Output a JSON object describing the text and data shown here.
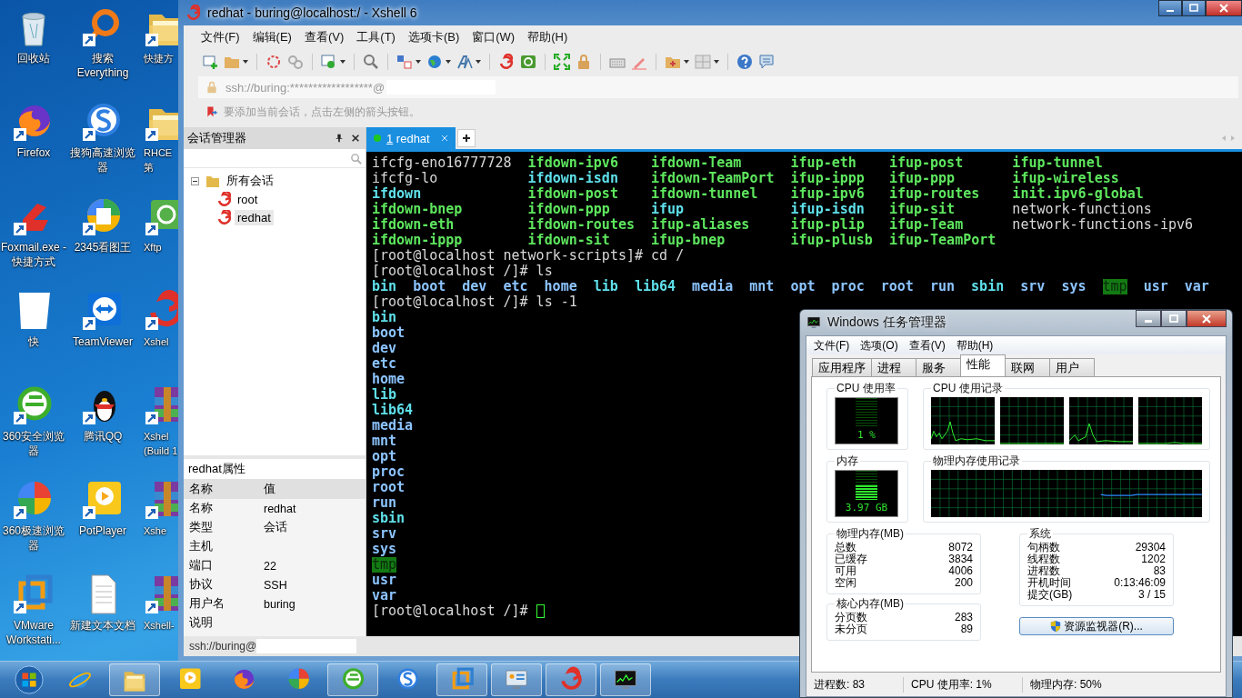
{
  "desktop_icons": [
    {
      "label": "回收站"
    },
    {
      "label": "搜索 Everything"
    },
    {
      "label": "快捷方"
    },
    {
      "label": "Firefox"
    },
    {
      "label": "搜狗高速浏览器"
    },
    {
      "label": "RHCE第"
    },
    {
      "label": "Foxmail.exe - 快捷方式"
    },
    {
      "label": "2345看图王"
    },
    {
      "label": "Xftp"
    },
    {
      "label": "快"
    },
    {
      "label": "TeamViewer"
    },
    {
      "label": "Xshel"
    },
    {
      "label": "360安全浏览器"
    },
    {
      "label": "腾讯QQ"
    },
    {
      "label": "Xshel (Build 1"
    },
    {
      "label": "360极速浏览器"
    },
    {
      "label": "PotPlayer"
    },
    {
      "label": "Xshe"
    },
    {
      "label": "VMware Workstati..."
    },
    {
      "label": "新建文本文档"
    },
    {
      "label": "Xshell-"
    }
  ],
  "xshell": {
    "title": "redhat - buring@localhost:/ - Xshell 6",
    "menu": [
      "文件(F)",
      "编辑(E)",
      "查看(V)",
      "工具(T)",
      "选项卡(B)",
      "窗口(W)",
      "帮助(H)"
    ],
    "address": "ssh://buring:******************@",
    "hint": "要添加当前会话，点击左侧的箭头按钮。",
    "session_manager": {
      "title": "会话管理器",
      "tree": [
        {
          "label": "所有会话",
          "expanded": true,
          "selected": false,
          "children": [
            {
              "label": "root",
              "selected": false
            },
            {
              "label": "redhat",
              "selected": true
            }
          ]
        }
      ]
    },
    "properties": {
      "title": "redhat属性",
      "columns": [
        "名称",
        "值"
      ],
      "rows": [
        {
          "name": "名称",
          "value": "redhat"
        },
        {
          "name": "类型",
          "value": "会话"
        },
        {
          "name": "主机"
        },
        {
          "name": "端口",
          "value": "22"
        },
        {
          "name": "协议",
          "value": "SSH"
        },
        {
          "name": "用户名",
          "value": "buring"
        },
        {
          "name": "说明"
        }
      ]
    },
    "tabs": [
      {
        "number": "1",
        "label": "redhat",
        "selected": true,
        "connected": true
      }
    ],
    "terminal": {
      "listing": [
        [
          {
            "text": "ifcfg-eno16777728",
            "kind": "plain"
          },
          {
            "text": "ifdown-ipv6",
            "kind": "exec"
          },
          {
            "text": "ifdown-Team",
            "kind": "exec"
          },
          {
            "text": "ifup-eth",
            "kind": "exec"
          },
          {
            "text": "ifup-post",
            "kind": "exec"
          },
          {
            "text": "ifup-tunnel",
            "kind": "exec"
          }
        ],
        [
          {
            "text": "ifcfg-lo",
            "kind": "plain"
          },
          {
            "text": "ifdown-isdn",
            "kind": "link"
          },
          {
            "text": "ifdown-TeamPort",
            "kind": "exec"
          },
          {
            "text": "ifup-ippp",
            "kind": "exec"
          },
          {
            "text": "ifup-ppp",
            "kind": "exec"
          },
          {
            "text": "ifup-wireless",
            "kind": "exec"
          }
        ],
        [
          {
            "text": "ifdown",
            "kind": "link"
          },
          {
            "text": "ifdown-post",
            "kind": "exec"
          },
          {
            "text": "ifdown-tunnel",
            "kind": "exec"
          },
          {
            "text": "ifup-ipv6",
            "kind": "exec"
          },
          {
            "text": "ifup-routes",
            "kind": "exec"
          },
          {
            "text": "init.ipv6-global",
            "kind": "exec"
          }
        ],
        [
          {
            "text": "ifdown-bnep",
            "kind": "exec"
          },
          {
            "text": "ifdown-ppp",
            "kind": "exec"
          },
          {
            "text": "ifup",
            "kind": "link"
          },
          {
            "text": "ifup-isdn",
            "kind": "link"
          },
          {
            "text": "ifup-sit",
            "kind": "exec"
          },
          {
            "text": "network-functions",
            "kind": "plain"
          }
        ],
        [
          {
            "text": "ifdown-eth",
            "kind": "exec"
          },
          {
            "text": "ifdown-routes",
            "kind": "exec"
          },
          {
            "text": "ifup-aliases",
            "kind": "exec"
          },
          {
            "text": "ifup-plip",
            "kind": "exec"
          },
          {
            "text": "ifup-Team",
            "kind": "exec"
          },
          {
            "text": "network-functions-ipv6",
            "kind": "plain"
          }
        ],
        [
          {
            "text": "ifdown-ippp",
            "kind": "exec"
          },
          {
            "text": "ifdown-sit",
            "kind": "exec"
          },
          {
            "text": "ifup-bnep",
            "kind": "exec"
          },
          {
            "text": "ifup-plusb",
            "kind": "exec"
          },
          {
            "text": "ifup-TeamPort",
            "kind": "exec"
          }
        ]
      ],
      "lines": [
        [
          {
            "text": "[root@localhost network-scripts]# cd /",
            "kind": "plain"
          }
        ],
        [
          {
            "text": "[root@localhost /]# ls",
            "kind": "plain"
          }
        ],
        [
          {
            "text": "bin",
            "kind": "link"
          },
          {
            "text": "boot",
            "kind": "dir"
          },
          {
            "text": "dev",
            "kind": "dir"
          },
          {
            "text": "etc",
            "kind": "dir"
          },
          {
            "text": "home",
            "kind": "dir"
          },
          {
            "text": "lib",
            "kind": "link"
          },
          {
            "text": "lib64",
            "kind": "link"
          },
          {
            "text": "media",
            "kind": "dir"
          },
          {
            "text": "mnt",
            "kind": "dir"
          },
          {
            "text": "opt",
            "kind": "dir"
          },
          {
            "text": "proc",
            "kind": "dir"
          },
          {
            "text": "root",
            "kind": "dir"
          },
          {
            "text": "run",
            "kind": "dir"
          },
          {
            "text": "sbin",
            "kind": "link"
          },
          {
            "text": "srv",
            "kind": "dir"
          },
          {
            "text": "sys",
            "kind": "dir"
          },
          {
            "text": "tmp",
            "kind": "sticky"
          },
          {
            "text": "usr",
            "kind": "dir"
          },
          {
            "text": "var",
            "kind": "dir"
          }
        ],
        [
          {
            "text": "[root@localhost /]# ls -1",
            "kind": "plain"
          }
        ],
        [
          {
            "text": "bin",
            "kind": "link"
          }
        ],
        [
          {
            "text": "boot",
            "kind": "dir"
          }
        ],
        [
          {
            "text": "dev",
            "kind": "dir"
          }
        ],
        [
          {
            "text": "etc",
            "kind": "dir"
          }
        ],
        [
          {
            "text": "home",
            "kind": "dir"
          }
        ],
        [
          {
            "text": "lib",
            "kind": "link"
          }
        ],
        [
          {
            "text": "lib64",
            "kind": "link"
          }
        ],
        [
          {
            "text": "media",
            "kind": "dir"
          }
        ],
        [
          {
            "text": "mnt",
            "kind": "dir"
          }
        ],
        [
          {
            "text": "opt",
            "kind": "dir"
          }
        ],
        [
          {
            "text": "proc",
            "kind": "dir"
          }
        ],
        [
          {
            "text": "root",
            "kind": "dir"
          }
        ],
        [
          {
            "text": "run",
            "kind": "dir"
          }
        ],
        [
          {
            "text": "sbin",
            "kind": "link"
          }
        ],
        [
          {
            "text": "srv",
            "kind": "dir"
          }
        ],
        [
          {
            "text": "sys",
            "kind": "dir"
          }
        ],
        [
          {
            "text": "tmp",
            "kind": "sticky"
          }
        ],
        [
          {
            "text": "usr",
            "kind": "dir"
          }
        ],
        [
          {
            "text": "var",
            "kind": "dir"
          }
        ],
        [
          {
            "text": "[root@localhost /]#",
            "kind": "plain"
          }
        ]
      ]
    },
    "status": "ssh://buring@"
  },
  "task_manager": {
    "title": "Windows 任务管理器",
    "menu": [
      "文件(F)",
      "选项(O)",
      "查看(V)",
      "帮助(H)"
    ],
    "tabs": [
      {
        "label": "应用程序",
        "selected": false
      },
      {
        "label": "进程",
        "selected": false
      },
      {
        "label": "服务",
        "selected": false
      },
      {
        "label": "性能",
        "selected": true
      },
      {
        "label": "联网",
        "selected": false
      },
      {
        "label": "用户",
        "selected": false
      }
    ],
    "cpu_usage": {
      "title": "CPU 使用率",
      "reading": "1 %",
      "level": 0.01
    },
    "cpu_history": {
      "title": "CPU 使用记录"
    },
    "memory": {
      "title": "内存",
      "reading": "3.97 GB",
      "level": 0.5
    },
    "memory_history": {
      "title": "物理内存使用记录"
    },
    "physical_memory": {
      "title": "物理内存(MB)",
      "rows": [
        {
          "name": "总数",
          "value": "8072"
        },
        {
          "name": "已缓存",
          "value": "3834"
        },
        {
          "name": "可用",
          "value": "4006"
        },
        {
          "name": "空闲",
          "value": "200"
        }
      ]
    },
    "kernel_memory": {
      "title": "核心内存(MB)",
      "rows": [
        {
          "name": "分页数",
          "value": "283"
        },
        {
          "name": "未分页",
          "value": "89"
        }
      ]
    },
    "system": {
      "title": "系统",
      "rows": [
        {
          "name": "句柄数",
          "value": "29304"
        },
        {
          "name": "线程数",
          "value": "1202"
        },
        {
          "name": "进程数",
          "value": "83"
        },
        {
          "name": "开机时间",
          "value": "0:13:46:09"
        },
        {
          "name": "提交(GB)",
          "value": "3 / 15"
        }
      ]
    },
    "button": "资源监视器(R)...",
    "status": [
      "进程数: 83",
      "CPU 使用率: 1%",
      "物理内存: 50%"
    ]
  },
  "taskbar": {
    "items": [
      {
        "running": false
      },
      {
        "running": true
      },
      {
        "running": false
      },
      {
        "running": false
      },
      {
        "running": false
      },
      {
        "running": true
      },
      {
        "running": false
      },
      {
        "running": true
      },
      {
        "running": true
      },
      {
        "running": true
      },
      {
        "running": true
      }
    ]
  }
}
